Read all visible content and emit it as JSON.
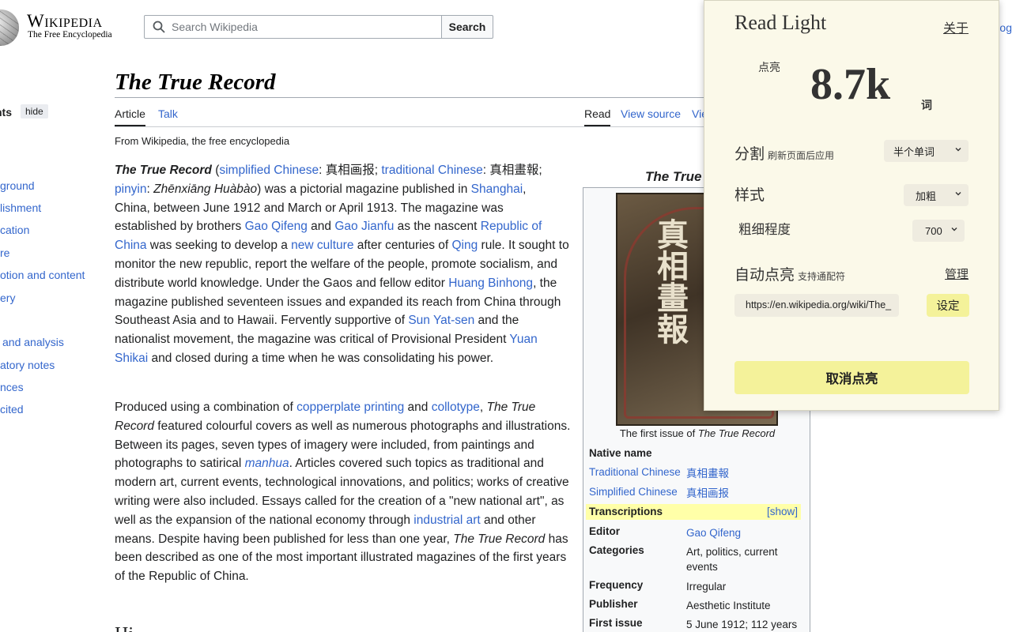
{
  "header": {
    "wordmark": "Wikipedia",
    "tagline": "The Free Encyclopedia",
    "search_placeholder": "Search Wikipedia",
    "search_button": "Search",
    "cut_text": "og"
  },
  "toc": {
    "heading": "nts",
    "hide_label": "hide",
    "items": [
      {
        "label": "ground"
      },
      {
        "label": "lishment"
      },
      {
        "label": "cation"
      },
      {
        "label": "re"
      },
      {
        "label": "otion and content"
      },
      {
        "label": "ery"
      },
      {
        "label": "and analysis"
      },
      {
        "label": "atory notes"
      },
      {
        "label": "nces"
      },
      {
        "label": "cited"
      }
    ]
  },
  "article": {
    "title": "The True Record",
    "tabs": {
      "article": "Article",
      "talk": "Talk",
      "read": "Read",
      "view_source": "View source",
      "view_history_cut": "Vie"
    },
    "from_line": "From Wikipedia, the free encyclopedia",
    "para1": {
      "t01": "The True Record",
      "t02": " (",
      "t03": "simplified Chinese",
      "t04": ": 真相画报; ",
      "t05": "traditional Chinese",
      "t06": ": 真相畫報;",
      "t07": "pinyin",
      "t08": ": ",
      "t09": "Zhēnxiāng Huàbào",
      "t10": ") was a pictorial magazine published in ",
      "t11": "Shanghai",
      "t12": ",",
      "t13": "China, between June 1912 and March or April 1913. The magazine was",
      "t14": "established by brothers ",
      "t15": "Gao Qifeng",
      "t16": " and ",
      "t17": "Gao Jianfu",
      "t18": " as the nascent ",
      "t19": "Republic of China",
      "t20": " was seeking to develop a ",
      "t21": "new culture",
      "t22": " after centuries of ",
      "t23": "Qing",
      "t24": " rule. It sought to monitor the new republic, report the welfare of the people, promote socialism, and distribute world knowledge. Under the Gaos and fellow editor ",
      "t25": "Huang Binhong",
      "t26": ", the magazine published seventeen issues and expanded its reach from China through Southeast Asia and to Hawaii. Fervently supportive of ",
      "t27": "Sun Yat-sen",
      "t28": " and the nationalist movement, the magazine was critical of Provisional President ",
      "t29": "Yuan Shikai",
      "t30": " and closed during a time when he was consolidating his power."
    },
    "para2": {
      "t01": "Produced using a combination of ",
      "t02": "copperplate printing",
      "t03": " and ",
      "t04": "collotype",
      "t05": ", ",
      "t06": "The True Record",
      "t07": " featured colourful covers as well as numerous photographs and illustrations. Between its pages, seven types of imagery were included, from paintings and photographs to satirical ",
      "t08": "manhua",
      "t09": ". Articles covered such topics as traditional and modern art, current events, technological innovations, and politics; works of creative writing were also included. Essays called for the creation of a \"new national art\", as well as the expansion of the national economy through ",
      "t10": "industrial art",
      "t11": " and other means. Despite having been published for less than one year, ",
      "t12": "The True Record",
      "t13": " has been described as one of the most important illustrated magazines of the first years of the Republic of China."
    },
    "next_heading_cut": "Hi"
  },
  "infobox": {
    "title": "The True",
    "cover_title": "真相畫報",
    "caption_prefix": "The first issue of ",
    "caption_italic": "The True Record",
    "native_name": "Native name",
    "trad_label": "Traditional Chinese",
    "trad_value": "真相畫報",
    "simp_label": "Simplified Chinese",
    "simp_value": "真相画报",
    "transcriptions": "Transcriptions",
    "show_label": "[show]",
    "editor_label": "Editor",
    "editor_value": "Gao Qifeng",
    "categories_label": "Categories",
    "categories_value": "Art, politics, current events",
    "frequency_label": "Frequency",
    "frequency_value": "Irregular",
    "publisher_label": "Publisher",
    "publisher_value": "Aesthetic Institute",
    "first_issue_label": "First issue",
    "first_issue_value": "5 June 1912; 112 years"
  },
  "popup": {
    "brand": "Read Light",
    "about": "关于",
    "lit_label": "点亮",
    "word_count": "8.7k",
    "word_unit": "词",
    "split_label": "分割",
    "split_sub": "刷新页面后应用",
    "split_value": "半个单词",
    "style_label": "样式",
    "style_value": "加粗",
    "weight_label": "粗细程度",
    "weight_value": "700",
    "auto_label": "自动点亮",
    "auto_sub": "支持通配符",
    "manage": "管理",
    "url_value": "https://en.wikipedia.org/wiki/The_",
    "set_button": "设定",
    "cancel_button": "取消点亮"
  }
}
